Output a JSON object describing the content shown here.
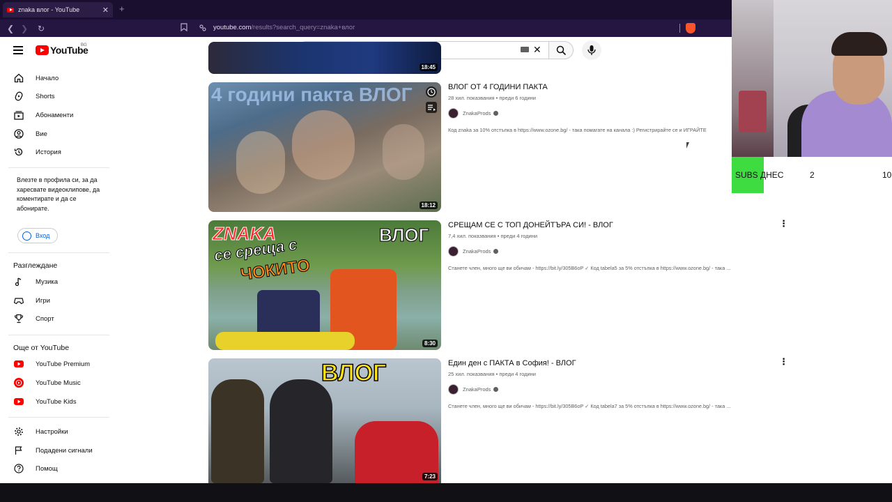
{
  "browser": {
    "tab_title": "znaka влог - YouTube",
    "tab_close": "✕",
    "new_tab": "+",
    "url_host": "youtube.com",
    "url_path": "/results?search_query=znaka+влог"
  },
  "youtube": {
    "logo": "YouTube",
    "region": "BG",
    "search_value": "znaka влог"
  },
  "sidebar": {
    "main": [
      {
        "label": "Начало",
        "icon": "home-icon"
      },
      {
        "label": "Shorts",
        "icon": "shorts-icon"
      },
      {
        "label": "Абонаменти",
        "icon": "subscriptions-icon"
      },
      {
        "label": "Вие",
        "icon": "you-icon"
      },
      {
        "label": "История",
        "icon": "history-icon"
      }
    ],
    "signin_note": "Влезте в профила си, за да харесвате видеоклипове, да коментирате и да се абонирате.",
    "signin_label": "Вход",
    "explore_heading": "Разглеждане",
    "explore": [
      {
        "label": "Музика",
        "icon": "music-icon"
      },
      {
        "label": "Игри",
        "icon": "games-icon"
      },
      {
        "label": "Спорт",
        "icon": "sports-icon"
      }
    ],
    "more_heading": "Още от YouTube",
    "more": [
      {
        "label": "YouTube Premium"
      },
      {
        "label": "YouTube Music"
      },
      {
        "label": "YouTube Kids"
      }
    ],
    "settings": [
      {
        "label": "Настройки",
        "icon": "gear-icon"
      },
      {
        "label": "Подадени сигнали",
        "icon": "flag-icon"
      },
      {
        "label": "Помощ",
        "icon": "help-icon"
      }
    ]
  },
  "results": [
    {
      "duration": "18:45"
    },
    {
      "title": "ВЛОГ ОТ 4 ГОДИНИ ПАКТА",
      "meta": "28 хил. показвания • преди 6 години",
      "channel": "ZnakaProds",
      "desc": "Код znaka за 10% отстъпка в https://www.ozone.bg/ - така помагате на канала :) Регистрирайте се и ИГРАЙТЕ",
      "duration": "18:12",
      "thumb_text": "4 години пакта ВЛОГ"
    },
    {
      "title": "СРЕЩАМ СЕ С ТОП ДОНЕЙТЪРА СИ! - ВЛОГ",
      "meta": "7,4 хил. показвания • преди 4 години",
      "channel": "ZnakaProds",
      "desc": "Станете член, много ще ви обичам - https://bit.ly/305B6oP ✓ Код tabela5 за 5% отстъпка в https://www.ozone.bg/ - така ...",
      "duration": "8:30",
      "thumb_text_1": "ZNAKA",
      "thumb_text_2": "се среща с",
      "thumb_text_3": "ЧОКИТО",
      "thumb_text_4": "ВЛОГ"
    },
    {
      "title": "Един ден с ПАКТА в София! - ВЛОГ",
      "meta": "25 хил. показвания • преди 4 години",
      "channel": "ZnakaProds",
      "desc": "Станете член, много ще ви обичам - https://bit.ly/305B6oP ✓ Код tabela7 за 5% отстъпка в https://www.ozone.bg/ - така ...",
      "duration": "7:23",
      "thumb_text": "ВЛОГ"
    }
  ],
  "overlay": {
    "subs_label": "SUBS ДНЕС",
    "subs_count": "2",
    "subs_goal": "10",
    "subs_progress": 0.2
  },
  "colors": {
    "youtube_red": "#ff0000",
    "subs_green": "#3fdc41",
    "browser_bg": "#241640"
  }
}
